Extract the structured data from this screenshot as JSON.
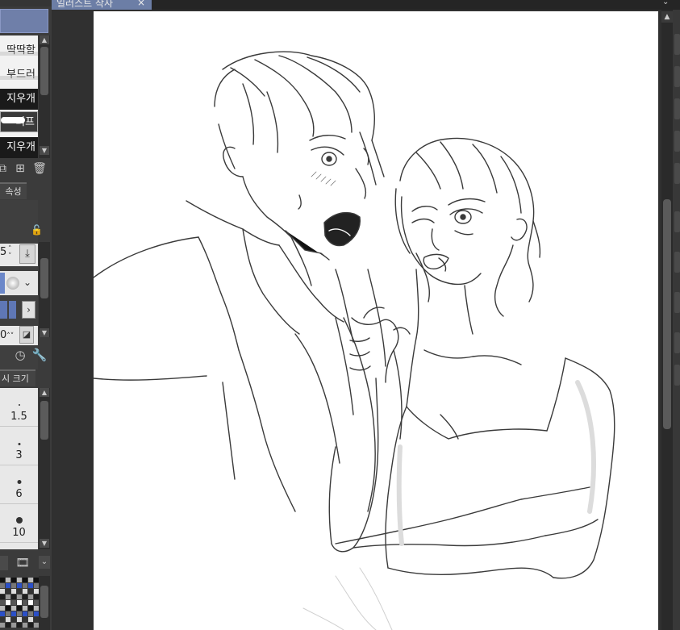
{
  "app": {
    "left_panel_tab": "",
    "document_tab": {
      "title": "일러스트 작사",
      "close_icon": "×"
    }
  },
  "subtool_panel": {
    "brushes": [
      {
        "label": "딱딱함"
      },
      {
        "label": "부드러움"
      },
      {
        "label": "지우개"
      },
      {
        "label": "러프"
      },
      {
        "label": "지우개"
      }
    ]
  },
  "property_panel": {
    "tab_label": "속성",
    "brush_size_value": "5",
    "stabilization_value": "0"
  },
  "brush_size_panel": {
    "tab_label": "시 크기",
    "sizes": [
      "1.5",
      "3",
      "6",
      "10"
    ]
  },
  "colors": {
    "accent": "#6c7ea6",
    "panel_bg": "#3b3b3b",
    "canvas_bg": "#303030"
  }
}
